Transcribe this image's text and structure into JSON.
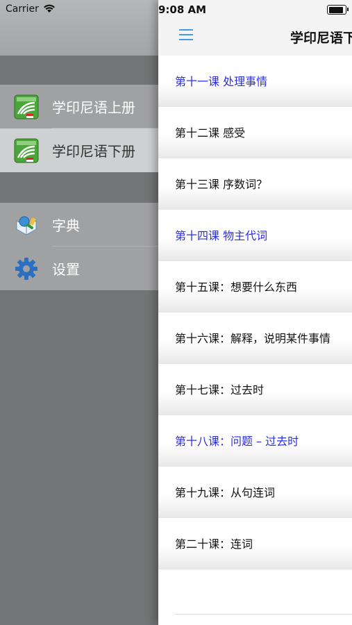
{
  "status_bar": {
    "carrier": "Carrier",
    "time": "9:08 AM"
  },
  "drawer": {
    "group1": [
      {
        "label": "学印尼语上册",
        "icon": "book-cover-icon"
      },
      {
        "label": "学印尼语下册",
        "icon": "book-cover-icon",
        "selected": true
      }
    ],
    "group2": [
      {
        "label": "字典",
        "icon": "dictionary-icon"
      },
      {
        "label": "设置",
        "icon": "gear-icon"
      }
    ]
  },
  "navbar": {
    "title": "学印尼语下"
  },
  "lessons": [
    {
      "label": "第十一课 处理事情",
      "highlight": true
    },
    {
      "label": "第十二课 感受",
      "highlight": false
    },
    {
      "label": "第十三课 序数词？",
      "highlight": false
    },
    {
      "label": "第十四课 物主代词",
      "highlight": true
    },
    {
      "label": "第十五课：想要什么东西",
      "highlight": false
    },
    {
      "label": "第十六课：解释，说明某件事情",
      "highlight": false
    },
    {
      "label": "第十七课：过去时",
      "highlight": false
    },
    {
      "label": "第十八课：问题 – 过去时",
      "highlight": true
    },
    {
      "label": "第十九课：从句连词",
      "highlight": false
    },
    {
      "label": "第二十课：连词",
      "highlight": false
    }
  ],
  "colors": {
    "highlight": "#2a2ee0",
    "accent": "#3d9be9"
  }
}
